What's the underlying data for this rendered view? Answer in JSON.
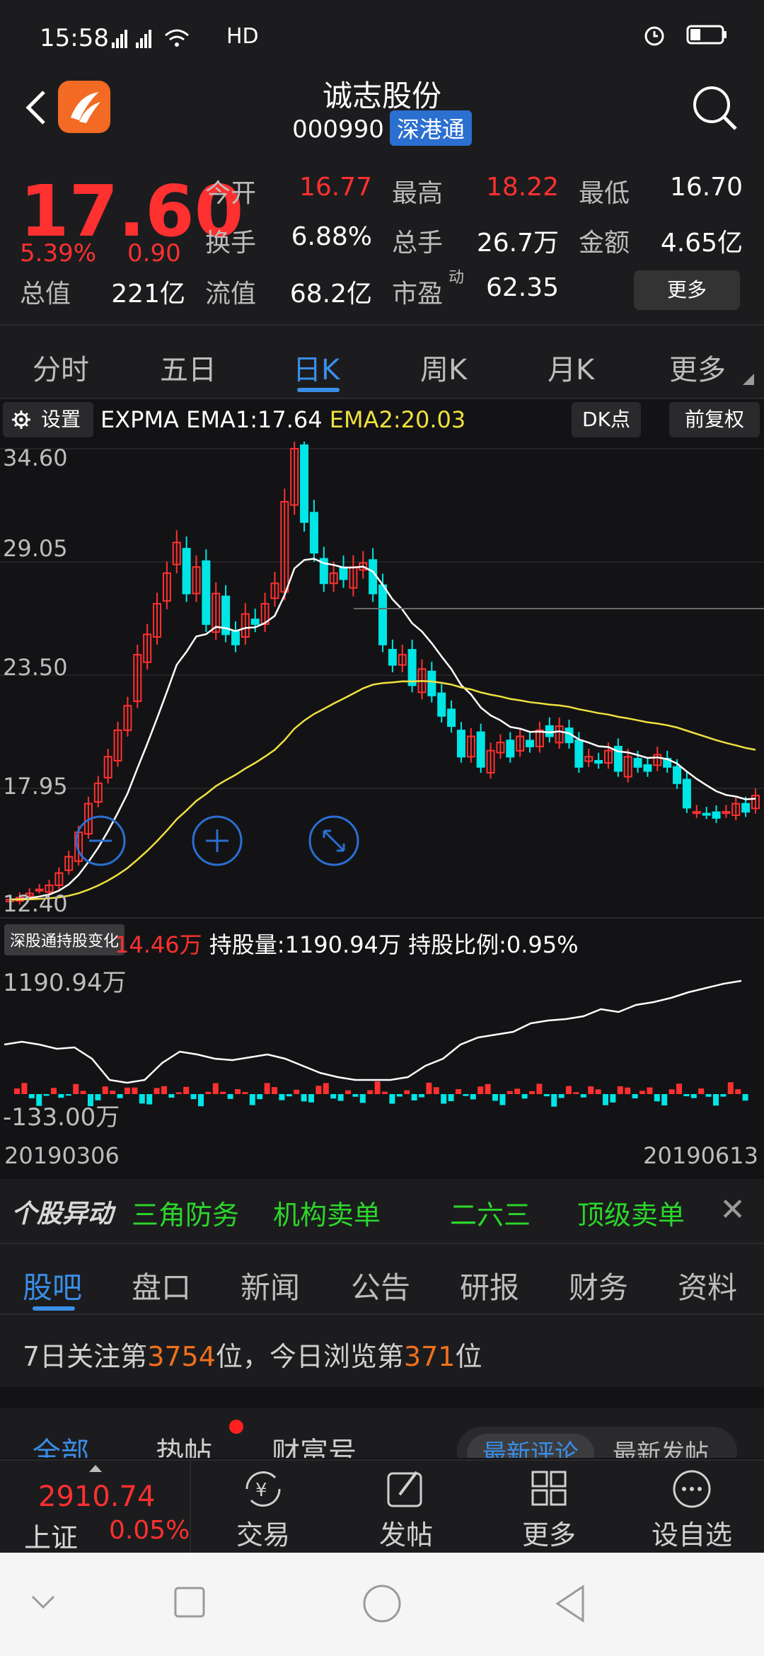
{
  "status": {
    "time": "15:58",
    "signal": "4G 4G",
    "hd": "HD"
  },
  "header": {
    "title": "诚志股份",
    "code": "000990",
    "badge": "深港通"
  },
  "quote": {
    "price": "17.60",
    "change_pct": "5.39%",
    "change": "0.90",
    "open_label": "今开",
    "open": "16.77",
    "high_label": "最高",
    "high": "18.22",
    "low_label": "最低",
    "low": "16.70",
    "turnover_label": "换手",
    "turnover": "6.88%",
    "volume_label": "总手",
    "volume": "26.7万",
    "amount_label": "金额",
    "amount": "4.65亿",
    "mcap_label": "总值",
    "mcap": "221亿",
    "float_label": "流值",
    "float": "68.2亿",
    "pe_label": "市盈",
    "pe_sup": "动",
    "pe": "62.35",
    "more": "更多"
  },
  "periods": [
    "分时",
    "五日",
    "日K",
    "周K",
    "月K",
    "更多"
  ],
  "indicator": {
    "settings": "设置",
    "ema1": "EXPMA EMA1:17.64",
    "ema2": "EMA2:20.03",
    "dk": "DK点",
    "adjust": "前复权"
  },
  "chart_data": {
    "type": "candlestick",
    "y_ticks": [
      "34.60",
      "29.05",
      "23.50",
      "17.95",
      "12.40"
    ],
    "ylim": [
      12.4,
      34.6
    ],
    "x_start": "20190306",
    "x_end": "20190613",
    "ema1_last": 17.64,
    "ema2_last": 20.03
  },
  "hold": {
    "tag": "深股通持股变化",
    "change": "14.46万",
    "amount": "持股量:1190.94万",
    "ratio": "持股比例:0.95%",
    "max": "1190.94万",
    "min": "-133.00万"
  },
  "dates": {
    "start": "20190306",
    "end": "20190613"
  },
  "alert": {
    "logo": "个股异动",
    "items": [
      "三角防务",
      "机构卖单",
      "二六三",
      "顶级卖单"
    ]
  },
  "tabs2": [
    "股吧",
    "盘口",
    "新闻",
    "公告",
    "研报",
    "财务",
    "资料"
  ],
  "rank": {
    "pre": "7日关注第",
    "n1": "3754",
    "mid": "位，今日浏览第",
    "n2": "371",
    "post": "位"
  },
  "posttabs": {
    "all": "全部",
    "hot": "热帖",
    "wealth": "财富号",
    "latest_comment": "最新评论",
    "latest_post": "最新发帖"
  },
  "index": {
    "value": "2910.74",
    "name": "上证",
    "pct": "0.05%"
  },
  "bottom": [
    "交易",
    "发帖",
    "更多",
    "设自选"
  ],
  "colors": {
    "up": "#ff3030",
    "down": "#00e5e5",
    "accent": "#3a8ee6",
    "ema2": "#f0e040"
  }
}
